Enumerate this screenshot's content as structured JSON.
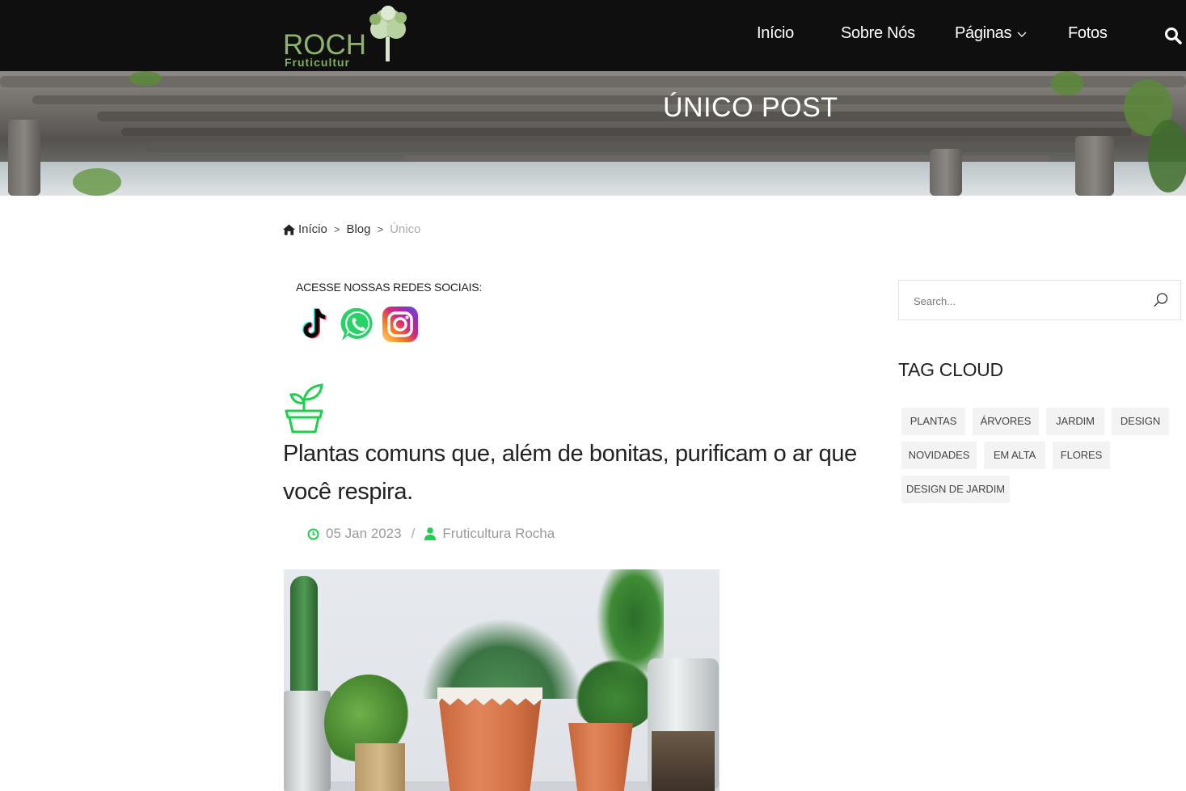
{
  "header": {
    "logo_main": "ROCH",
    "logo_sub": "Fruticultur",
    "nav": [
      {
        "label": "Início"
      },
      {
        "label": "Sobre Nós"
      },
      {
        "label": "Páginas"
      },
      {
        "label": "Fotos"
      }
    ],
    "search_icon": "search-icon"
  },
  "hero": {
    "title": "ÚNICO POST"
  },
  "breadcrumb": {
    "home": "Início",
    "blog": "Blog",
    "current": "Único",
    "separator": ">"
  },
  "social": {
    "label": "ACESSE NOSSAS REDES SOCIAIS:",
    "icons": [
      "tiktok-icon",
      "whatsapp-icon",
      "instagram-icon"
    ]
  },
  "post": {
    "title": "Plantas comuns que, além de bonitas, purificam o ar que você respira.",
    "date": "05 Jan 2023",
    "author": "Fruticultura Rocha",
    "meta_separator": "/"
  },
  "sidebar": {
    "search_placeholder": "Search...",
    "tag_cloud_title": "TAG CLOUD",
    "tags": [
      "PLANTAS",
      "ÁRVORES",
      "JARDIM",
      "DESIGN",
      "NOVIDADES",
      "EM ALTA",
      "FLORES",
      "DESIGN DE JARDIM"
    ]
  },
  "colors": {
    "header_bg": "#0f0f0f",
    "accent_green": "#1fcf4e",
    "logo_green": "#8fb26f",
    "tag_bg": "#f3f3f3"
  }
}
